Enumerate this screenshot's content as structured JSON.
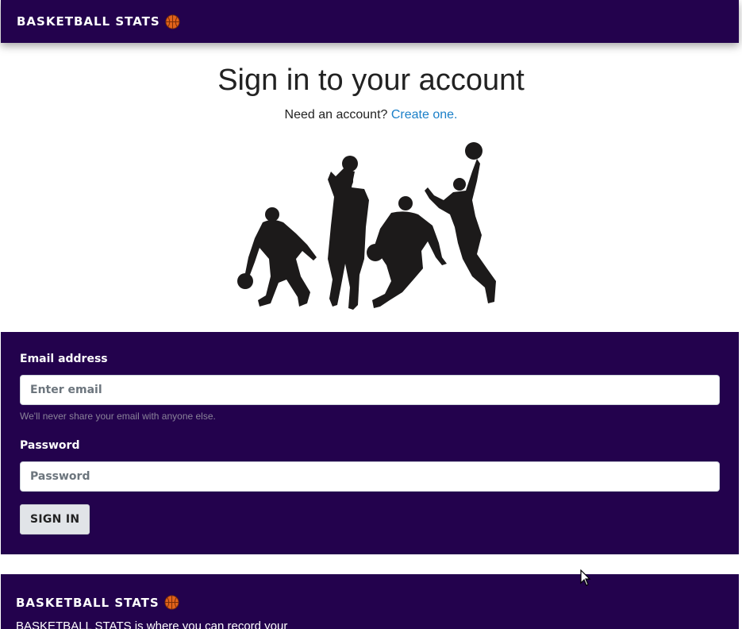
{
  "navbar": {
    "brand": "BASKETBALL STATS",
    "brand_icon": "basketball-icon"
  },
  "header": {
    "title": "Sign in to your account",
    "subtitle_prefix": "Need an account?",
    "create_link": "Create one."
  },
  "hero": {
    "image": "basketball-players-silhouette"
  },
  "form": {
    "email_label": "Email address",
    "email_placeholder": "Enter email",
    "email_value": "",
    "email_help": "We'll never share your email with anyone else.",
    "password_label": "Password",
    "password_placeholder": "Password",
    "password_value": "",
    "submit_label": "SIGN IN"
  },
  "footer": {
    "brand": "BASKETBALL STATS",
    "description": "BASKETBALL STATS is where you can record your"
  },
  "colors": {
    "brand_purple": "#23024d",
    "link_blue": "#1a7fc8",
    "ball_orange": "#e0621b"
  }
}
